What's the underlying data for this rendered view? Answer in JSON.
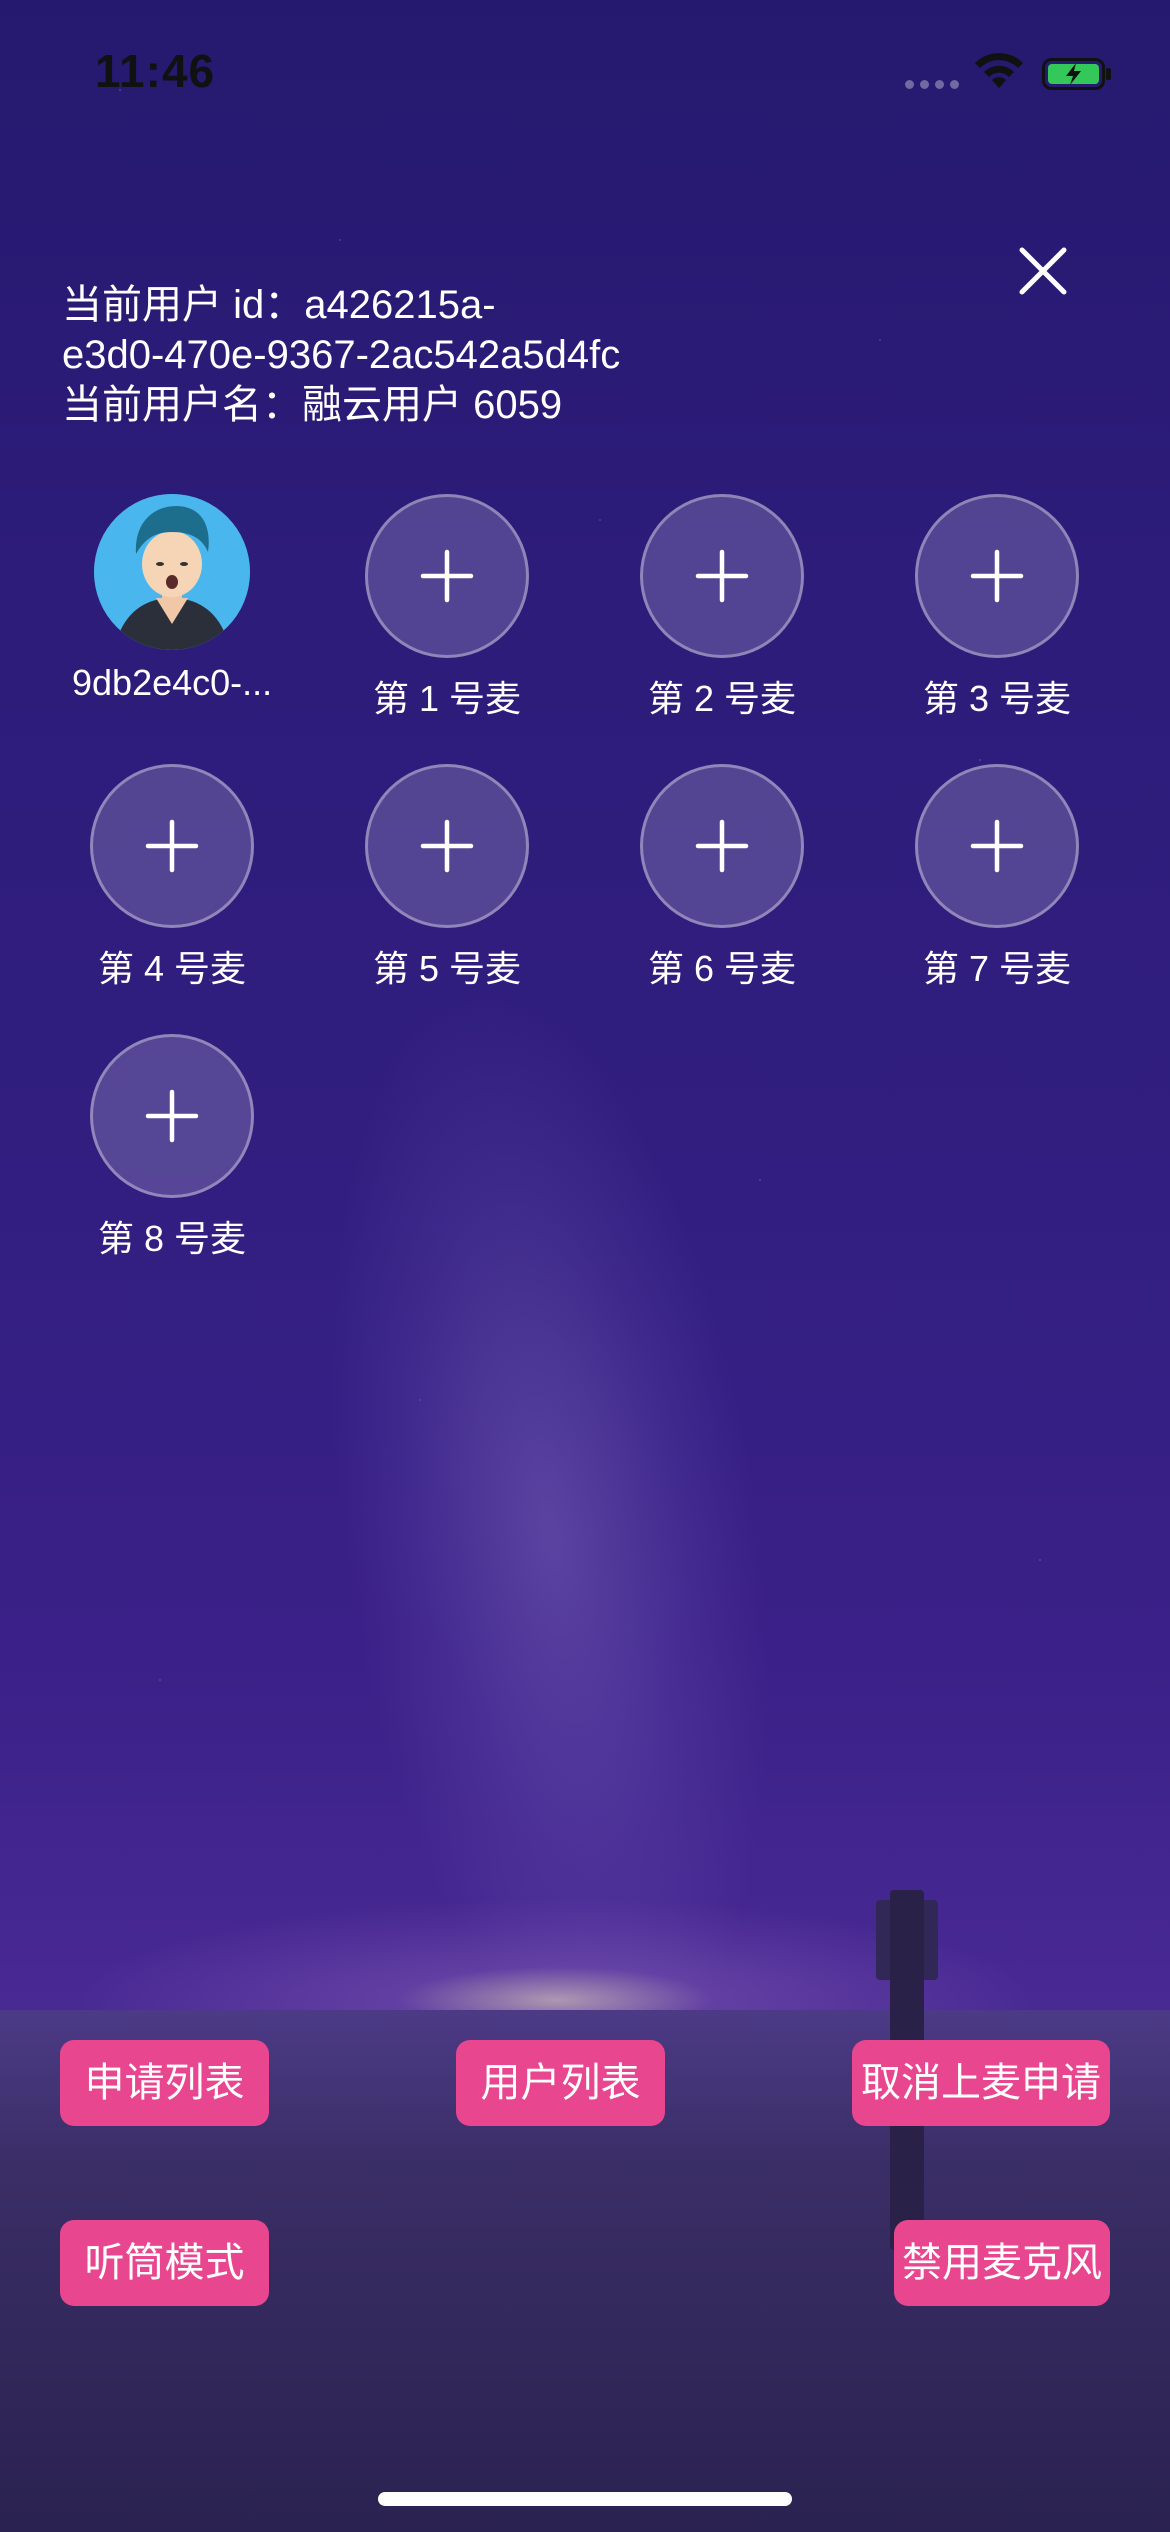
{
  "status_bar": {
    "time": "11:46",
    "wifi_icon": "wifi-icon",
    "battery_icon": "battery-charging-icon"
  },
  "close_icon": "close-icon",
  "user": {
    "id_line_1": "当前用户 id：a426215a-",
    "id_line_2": "e3d0-470e-9367-2ac542a5d4fc",
    "name_line": "当前用户名：融云用户 6059"
  },
  "seats": [
    {
      "label": "9db2e4c0-...",
      "occupied": true
    },
    {
      "label": "第 1 号麦",
      "occupied": false
    },
    {
      "label": "第 2 号麦",
      "occupied": false
    },
    {
      "label": "第 3 号麦",
      "occupied": false
    },
    {
      "label": "第 4 号麦",
      "occupied": false
    },
    {
      "label": "第 5 号麦",
      "occupied": false
    },
    {
      "label": "第 6 号麦",
      "occupied": false
    },
    {
      "label": "第 7 号麦",
      "occupied": false
    },
    {
      "label": "第 8 号麦",
      "occupied": false
    }
  ],
  "buttons": {
    "apply_list": "申请列表",
    "user_list": "用户列表",
    "cancel_apply": "取消上麦申请",
    "earpiece_mode": "听筒模式",
    "disable_mic": "禁用麦克风"
  },
  "colors": {
    "button": "#e8468f",
    "background_top": "#25196f",
    "background_bottom": "#2c2158"
  }
}
